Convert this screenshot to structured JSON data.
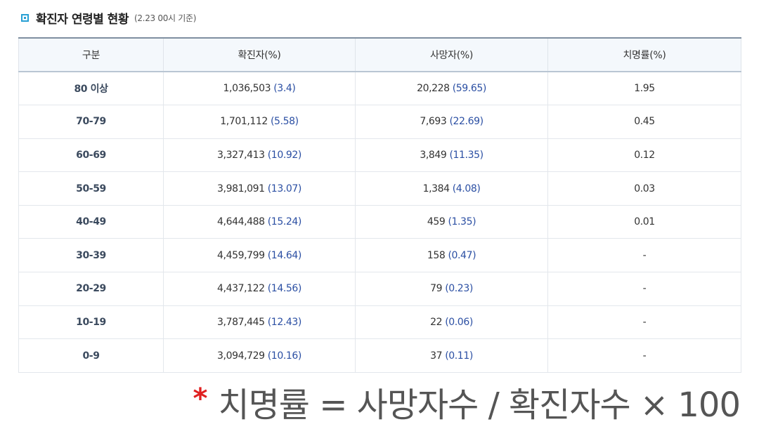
{
  "header": {
    "title": "확진자 연령별 현황",
    "subtitle": "(2.23 00시 기준)"
  },
  "table": {
    "headers": [
      "구분",
      "확진자(%)",
      "사망자(%)",
      "치명률(%)"
    ],
    "rows": [
      {
        "age": "80 이상",
        "cases": "1,036,503",
        "cases_pct": "(3.4)",
        "deaths": "20,228",
        "deaths_pct": "(59.65)",
        "rate": "1.95"
      },
      {
        "age": "70-79",
        "cases": "1,701,112",
        "cases_pct": "(5.58)",
        "deaths": "7,693",
        "deaths_pct": "(22.69)",
        "rate": "0.45"
      },
      {
        "age": "60-69",
        "cases": "3,327,413",
        "cases_pct": "(10.92)",
        "deaths": "3,849",
        "deaths_pct": "(11.35)",
        "rate": "0.12"
      },
      {
        "age": "50-59",
        "cases": "3,981,091",
        "cases_pct": "(13.07)",
        "deaths": "1,384",
        "deaths_pct": "(4.08)",
        "rate": "0.03"
      },
      {
        "age": "40-49",
        "cases": "4,644,488",
        "cases_pct": "(15.24)",
        "deaths": "459",
        "deaths_pct": "(1.35)",
        "rate": "0.01"
      },
      {
        "age": "30-39",
        "cases": "4,459,799",
        "cases_pct": "(14.64)",
        "deaths": "158",
        "deaths_pct": "(0.47)",
        "rate": "-"
      },
      {
        "age": "20-29",
        "cases": "4,437,122",
        "cases_pct": "(14.56)",
        "deaths": "79",
        "deaths_pct": "(0.23)",
        "rate": "-"
      },
      {
        "age": "10-19",
        "cases": "3,787,445",
        "cases_pct": "(12.43)",
        "deaths": "22",
        "deaths_pct": "(0.06)",
        "rate": "-"
      },
      {
        "age": "0-9",
        "cases": "3,094,729",
        "cases_pct": "(10.16)",
        "deaths": "37",
        "deaths_pct": "(0.11)",
        "rate": "-"
      }
    ]
  },
  "formula": {
    "marker": "*",
    "text": "치명률 = 사망자수 / 확진자수 × 100"
  },
  "colors": {
    "accent": "#29a0d4",
    "value_blue": "#2b4fa3",
    "marker_red": "#e02020"
  },
  "icons": {
    "title_bullet": "square-bullet-icon"
  }
}
